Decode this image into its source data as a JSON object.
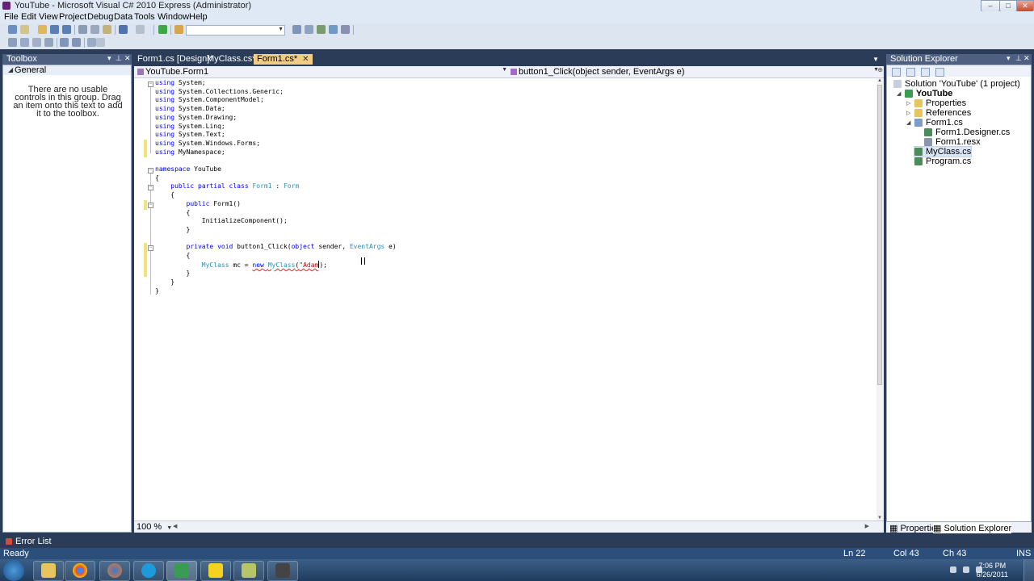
{
  "window": {
    "title": "YouTube - Microsoft Visual C# 2010 Express (Administrator)"
  },
  "menu": [
    "File",
    "Edit",
    "View",
    "Project",
    "Debug",
    "Data",
    "Tools",
    "Window",
    "Help"
  ],
  "toolbox": {
    "title": "Toolbox",
    "group": "General",
    "empty_text": "There are no usable controls in this group. Drag an item onto this text to add it to the toolbox."
  },
  "editor": {
    "tabs": [
      {
        "label": "Form1.cs [Design]*",
        "active": false
      },
      {
        "label": "MyClass.cs*",
        "active": false
      },
      {
        "label": "Form1.cs*",
        "active": true
      }
    ],
    "nav_class": "YouTube.Form1",
    "nav_member": "button1_Click(object sender, EventArgs e)",
    "zoom": "100 %"
  },
  "solution_explorer": {
    "title": "Solution Explorer",
    "tree": [
      {
        "label": "Solution 'YouTube' (1 project)",
        "level": 0,
        "icon": "solution-icon",
        "bold": false
      },
      {
        "label": "YouTube",
        "level": 1,
        "icon": "csharp-project-icon",
        "bold": true
      },
      {
        "label": "Properties",
        "level": 2,
        "icon": "folder-icon",
        "bold": false
      },
      {
        "label": "References",
        "level": 2,
        "icon": "folder-icon",
        "bold": false
      },
      {
        "label": "Form1.cs",
        "level": 2,
        "icon": "form-icon",
        "bold": false
      },
      {
        "label": "Form1.Designer.cs",
        "level": 3,
        "icon": "cs-file-icon",
        "bold": false
      },
      {
        "label": "Form1.resx",
        "level": 3,
        "icon": "resx-file-icon",
        "bold": false
      },
      {
        "label": "MyClass.cs",
        "level": 2,
        "icon": "cs-file-icon",
        "bold": false
      },
      {
        "label": "Program.cs",
        "level": 2,
        "icon": "cs-file-icon",
        "bold": false
      }
    ],
    "bottom_tabs": [
      "Properties",
      "Solution Explorer"
    ]
  },
  "error_list": "Error List",
  "status": {
    "state": "Ready",
    "line": "Ln 22",
    "col": "Col 43",
    "ch": "Ch 43",
    "mode": "INS"
  },
  "clock": {
    "time": "7:06 PM",
    "date": "6/26/2011"
  }
}
